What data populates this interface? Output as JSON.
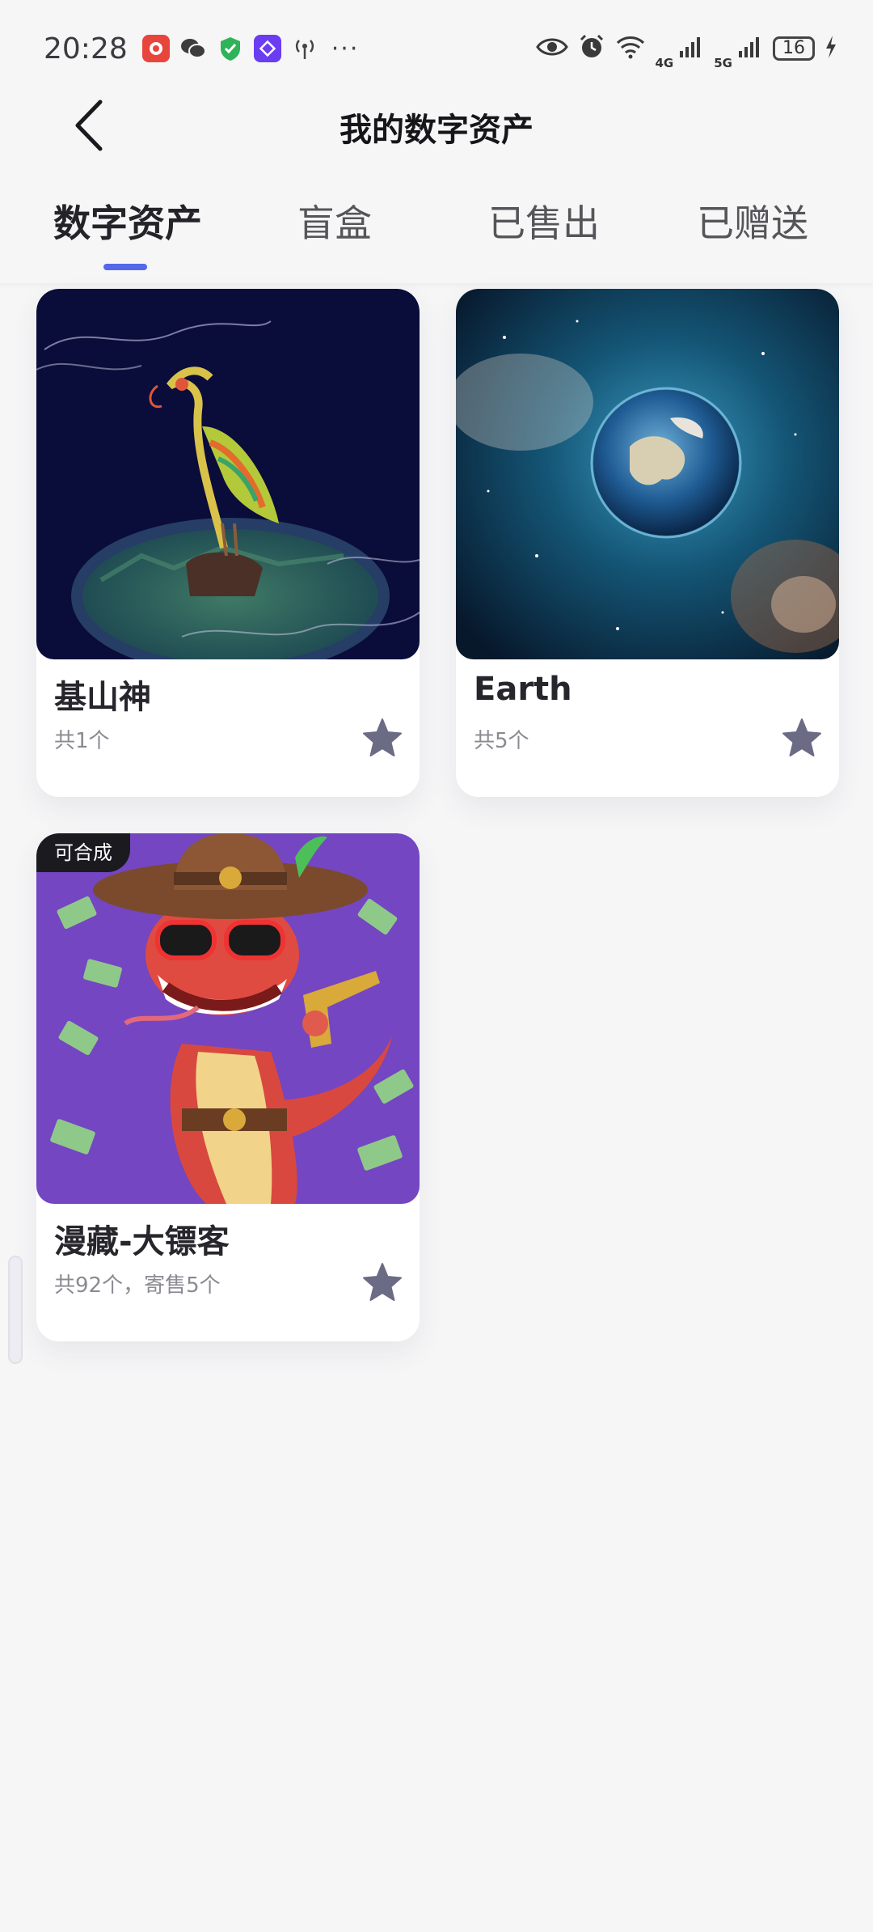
{
  "status_bar": {
    "time": "20:28",
    "net1": "4G",
    "net2": "5G",
    "battery": "16",
    "more": "···"
  },
  "nav": {
    "title": "我的数字资产"
  },
  "tabs": [
    {
      "label": "数字资产",
      "active": true
    },
    {
      "label": "盲盒",
      "active": false
    },
    {
      "label": "已售出",
      "active": false
    },
    {
      "label": "已赠送",
      "active": false
    }
  ],
  "cards": [
    {
      "title": "基山神",
      "subtitle": "共1个",
      "badge": "",
      "image": "dragon-phoenix-artwork"
    },
    {
      "title": "Earth",
      "subtitle": "共5个",
      "badge": "",
      "image": "earth-in-space-artwork"
    },
    {
      "title": "漫藏-大镖客",
      "subtitle": "共92个，寄售5个",
      "badge": "可合成",
      "image": "cowboy-snake-artwork"
    }
  ],
  "colors": {
    "accent": "#5468e8",
    "star": "#6b6b85",
    "background": "#f6f6f7"
  }
}
